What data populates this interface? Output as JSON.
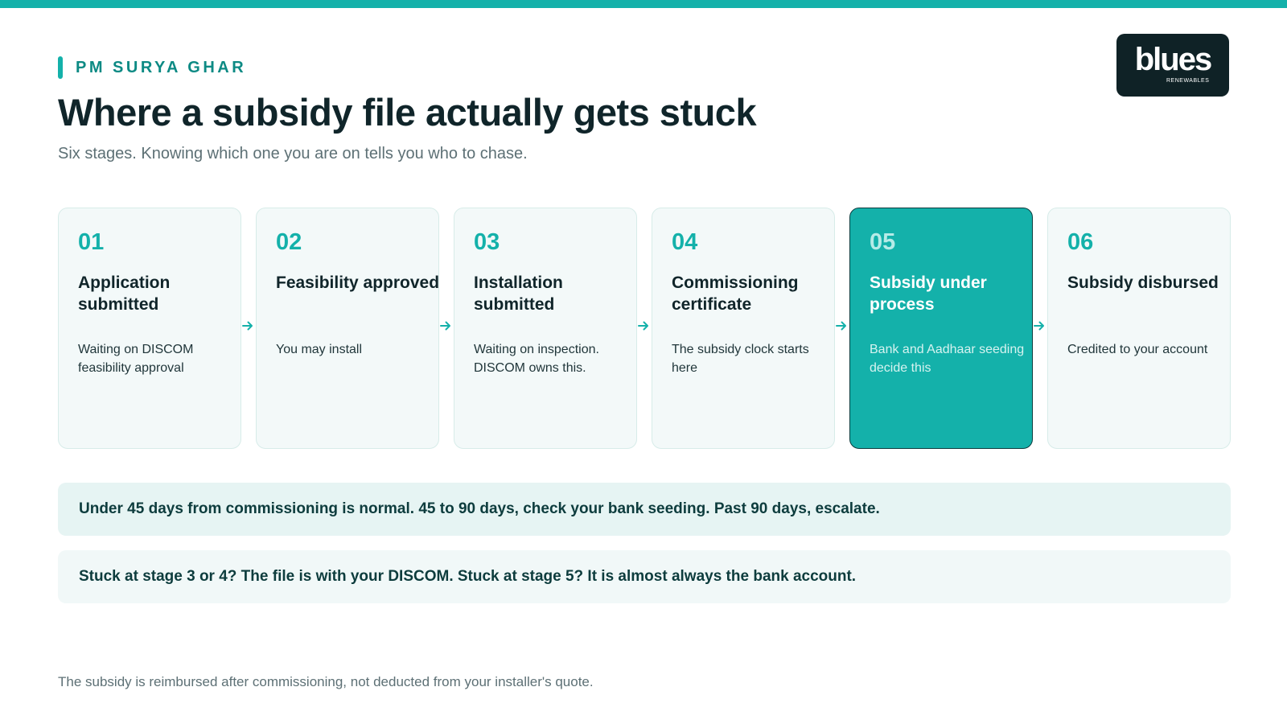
{
  "eyebrow": "PM SURYA GHAR",
  "title": "Where a subsidy file actually gets stuck",
  "subtitle": "Six stages. Knowing which one you are on tells you who to chase.",
  "logo": {
    "word": "blues",
    "sub": "RENEWABLES"
  },
  "stages": [
    {
      "num": "01",
      "title_line1": "Application",
      "title_line2": "submitted",
      "desc_line1": "Waiting on DISCOM",
      "desc_line2": "feasibility approval",
      "active": false
    },
    {
      "num": "02",
      "title_line1": "Feasibility approved",
      "title_line2": "",
      "desc_line1": "You may install",
      "desc_line2": "",
      "active": false
    },
    {
      "num": "03",
      "title_line1": "Installation",
      "title_line2": "submitted",
      "desc_line1": "Waiting on inspection.",
      "desc_line2": "DISCOM owns this.",
      "active": false
    },
    {
      "num": "04",
      "title_line1": "Commissioning",
      "title_line2": "certificate",
      "desc_line1": "The subsidy clock starts",
      "desc_line2": "here",
      "active": false
    },
    {
      "num": "05",
      "title_line1": "Subsidy under",
      "title_line2": "process",
      "desc_line1": "Bank and Aadhaar seeding",
      "desc_line2": "decide this",
      "active": true
    },
    {
      "num": "06",
      "title_line1": "Subsidy disbursed",
      "title_line2": "",
      "desc_line1": "Credited to your account",
      "desc_line2": "",
      "active": false
    }
  ],
  "callouts": [
    "Under 45 days from commissioning is normal. 45 to 90 days, check your bank seeding. Past 90 days, escalate.",
    "Stuck at stage 3 or 4? The file is with your DISCOM. Stuck at stage 5? It is almost always the bank account."
  ],
  "footnote": "The subsidy is reimbursed after commissioning, not deducted from your installer's quote.",
  "colors": {
    "accent": "#14b1aa",
    "active_border": "#0c3c3e",
    "logo_bg": "#0f2226",
    "title": "#10252a"
  },
  "icons": {
    "connector": "arrow-right-icon"
  }
}
